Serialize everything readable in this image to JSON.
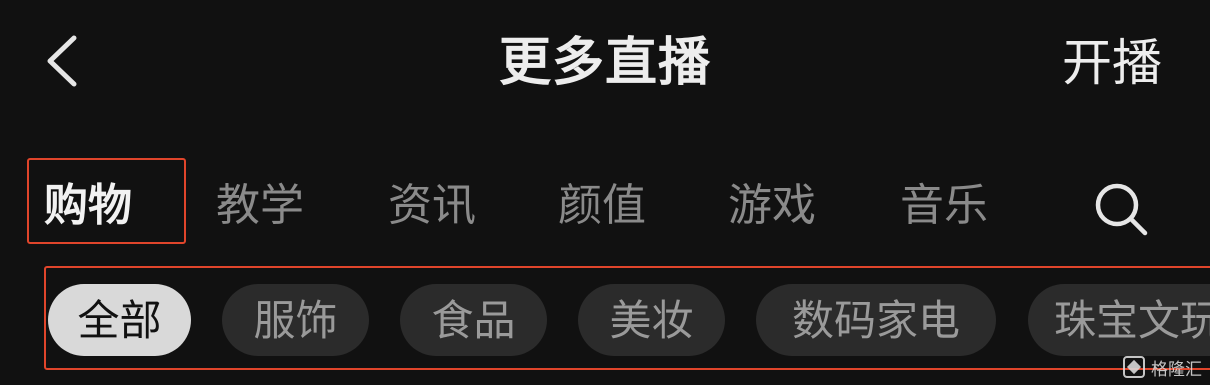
{
  "header": {
    "title": "更多直播",
    "start_live_label": "开播",
    "back_icon": "chevron-left-icon"
  },
  "tabs": [
    {
      "label": "购物",
      "active": true
    },
    {
      "label": "教学",
      "active": false
    },
    {
      "label": "资讯",
      "active": false
    },
    {
      "label": "颜值",
      "active": false
    },
    {
      "label": "游戏",
      "active": false
    },
    {
      "label": "音乐",
      "active": false
    }
  ],
  "search_icon": "search-icon",
  "chips": [
    {
      "label": "全部",
      "active": true
    },
    {
      "label": "服饰",
      "active": false
    },
    {
      "label": "食品",
      "active": false
    },
    {
      "label": "美妆",
      "active": false
    },
    {
      "label": "数码家电",
      "active": false
    },
    {
      "label": "珠宝文玩",
      "active": false
    }
  ],
  "watermark": "格隆汇",
  "colors": {
    "background": "#111111",
    "highlight_box": "#e0452b",
    "active_chip_bg": "#d9d9d9",
    "chip_bg": "#2b2b2b"
  }
}
